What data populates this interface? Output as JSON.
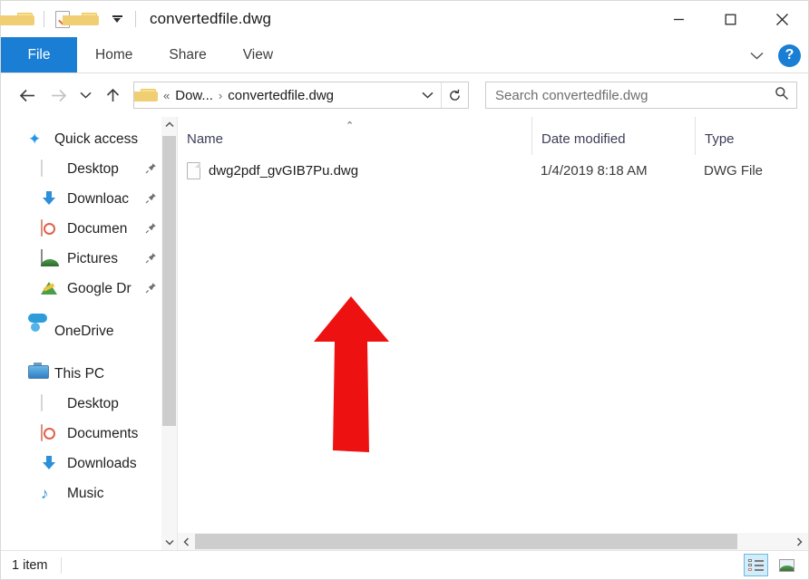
{
  "window": {
    "title": "convertedfile.dwg",
    "quick_access_toolbar": [
      {
        "name": "folder-icon",
        "label": "Folder"
      },
      {
        "name": "properties-icon",
        "label": "Properties"
      },
      {
        "name": "new-folder-icon",
        "label": "New folder"
      },
      {
        "name": "chevron-down-icon",
        "label": "Customize Quick Access Toolbar"
      }
    ],
    "controls": {
      "minimize": "Minimize",
      "maximize": "Maximize",
      "close": "Close"
    }
  },
  "ribbon": {
    "tabs": [
      {
        "label": "File",
        "active": true
      },
      {
        "label": "Home",
        "active": false
      },
      {
        "label": "Share",
        "active": false
      },
      {
        "label": "View",
        "active": false
      }
    ],
    "expand_label": "Expand the Ribbon",
    "help_label": "?",
    "accent_color": "#1a7fd4"
  },
  "address_bar": {
    "back": "Back",
    "forward": "Forward",
    "recent": "Recent locations",
    "up": "Up",
    "breadcrumb": {
      "overflow": "«",
      "separator": "›",
      "items": [
        "Dow...",
        "convertedfile.dwg"
      ]
    },
    "dropdown": "Previous locations",
    "refresh": "Refresh",
    "search": {
      "placeholder": "Search convertedfile.dwg",
      "icon": "search-icon"
    }
  },
  "sidebar": {
    "groups": [
      {
        "header": {
          "label": "Quick access",
          "icon": "star-icon"
        },
        "items": [
          {
            "label": "Desktop",
            "icon": "desktop-icon",
            "pinned": true
          },
          {
            "label": "Downloac",
            "icon": "download-icon",
            "pinned": true
          },
          {
            "label": "Documen",
            "icon": "documents-icon",
            "pinned": true
          },
          {
            "label": "Pictures",
            "icon": "pictures-icon",
            "pinned": true
          },
          {
            "label": "Google Dr",
            "icon": "google-drive-icon",
            "pinned": true
          }
        ]
      },
      {
        "header": {
          "label": "OneDrive",
          "icon": "onedrive-icon"
        },
        "items": []
      },
      {
        "header": {
          "label": "This PC",
          "icon": "this-pc-icon"
        },
        "items": [
          {
            "label": "Desktop",
            "icon": "desktop-icon",
            "pinned": false
          },
          {
            "label": "Documents",
            "icon": "documents-icon",
            "pinned": false
          },
          {
            "label": "Downloads",
            "icon": "download-icon",
            "pinned": false
          },
          {
            "label": "Music",
            "icon": "music-icon",
            "pinned": false
          }
        ]
      }
    ],
    "pin_glyph": "📌"
  },
  "file_list": {
    "columns": [
      {
        "label": "Name",
        "sorted": "ascending"
      },
      {
        "label": "Date modified",
        "sorted": ""
      },
      {
        "label": "Type",
        "sorted": ""
      }
    ],
    "sort_glyph": "⌃",
    "rows": [
      {
        "name": "dwg2pdf_gvGIB7Pu.dwg",
        "date_modified": "1/4/2019 8:18 AM",
        "type": "DWG File",
        "icon": "generic-file-icon"
      }
    ]
  },
  "annotation": {
    "type": "arrow",
    "direction": "up",
    "color": "#ee1111",
    "points_at": "dwg2pdf_gvGIB7Pu.dwg"
  },
  "status_bar": {
    "item_count": "1 item",
    "view_buttons": [
      {
        "name": "details-view-button",
        "label": "Details",
        "active": true
      },
      {
        "name": "large-icons-view-button",
        "label": "Large icons",
        "active": false
      }
    ]
  }
}
